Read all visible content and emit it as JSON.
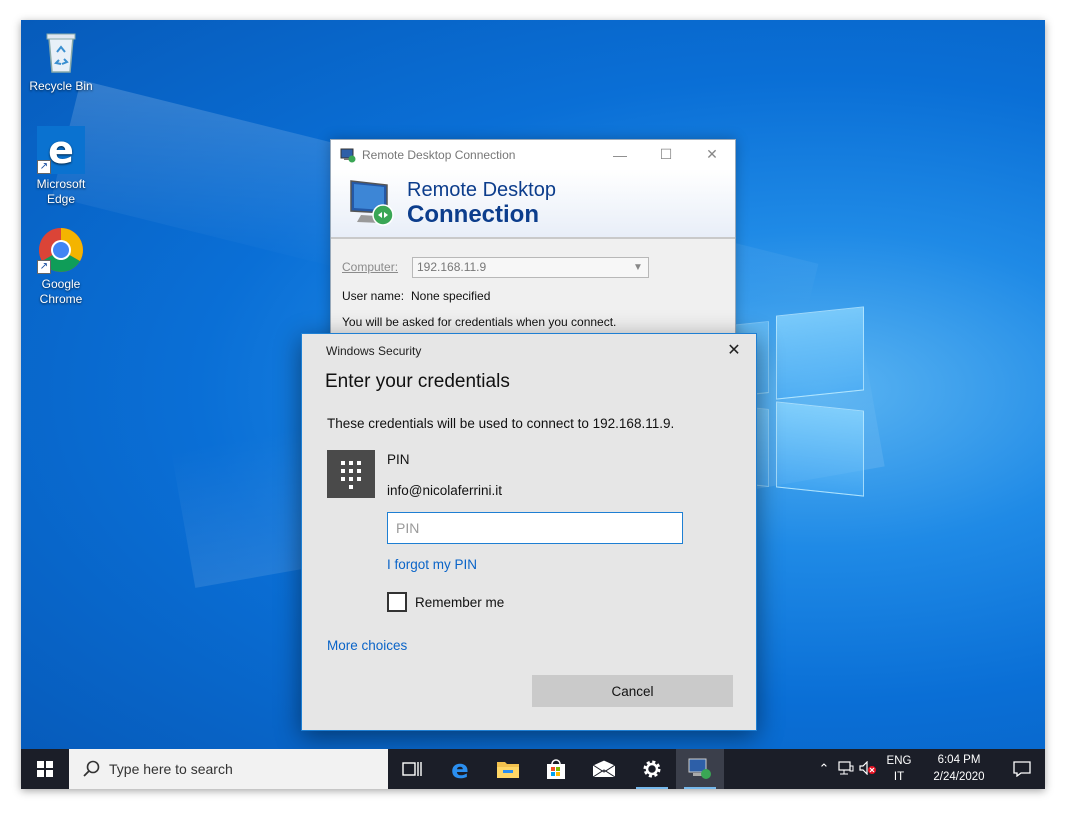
{
  "desktop": {
    "icons": [
      {
        "label": "Recycle Bin"
      },
      {
        "label": "Microsoft Edge"
      },
      {
        "label": "Google Chrome"
      }
    ]
  },
  "rdc_window": {
    "title": "Remote Desktop Connection",
    "banner_line1": "Remote Desktop",
    "banner_line2": "Connection",
    "computer_label": "Computer:",
    "computer_value": "192.168.11.9",
    "username_label": "User name:",
    "username_value": "None specified",
    "info_text": "You will be asked for credentials when you connect."
  },
  "security_dialog": {
    "caption": "Windows Security",
    "heading": "Enter your credentials",
    "description": "These credentials will be used to connect to 192.168.11.9.",
    "provider": "PIN",
    "account": "info@nicolaferrini.it",
    "pin_placeholder": "PIN",
    "forgot_pin": "I forgot my PIN",
    "remember_me": "Remember me",
    "more_choices": "More choices",
    "cancel": "Cancel"
  },
  "taskbar": {
    "search_placeholder": "Type here to search",
    "lang_line1": "ENG",
    "lang_line2": "IT",
    "time": "6:04 PM",
    "date": "2/24/2020"
  },
  "colors": {
    "accent": "#1e7fd3",
    "link": "#0a64c8",
    "taskbar": "#1b1e28",
    "rdc_brand": "#0c3d8c"
  }
}
